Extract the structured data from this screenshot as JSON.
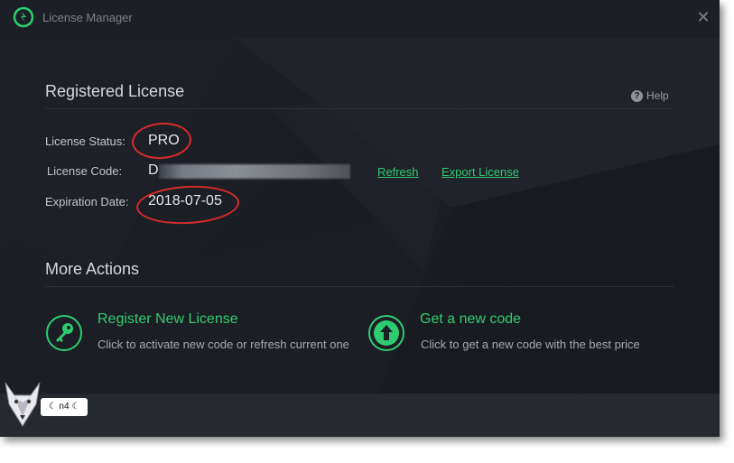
{
  "window": {
    "title": "License Manager"
  },
  "registered": {
    "heading": "Registered License",
    "help_label": "Help",
    "status_label": "License Status:",
    "status_value": "PRO",
    "code_label": "License Code:",
    "code_value": "D",
    "expiration_label": "Expiration Date:",
    "expiration_value": "2018-07-05",
    "refresh_link": "Refresh",
    "export_link": "Export License"
  },
  "more_actions": {
    "heading": "More Actions",
    "actions": [
      {
        "title": "Register New License",
        "desc": "Click to activate new code or refresh current one",
        "icon": "key-icon"
      },
      {
        "title": "Get a new code",
        "desc": "Click to get a new code with the best price",
        "icon": "arrow-up-icon"
      }
    ]
  },
  "watermark": {
    "badge": "☾ n4 ☾"
  },
  "colors": {
    "accent": "#2ecc71",
    "background": "#1c1f25",
    "annotation": "#d82a2a"
  }
}
